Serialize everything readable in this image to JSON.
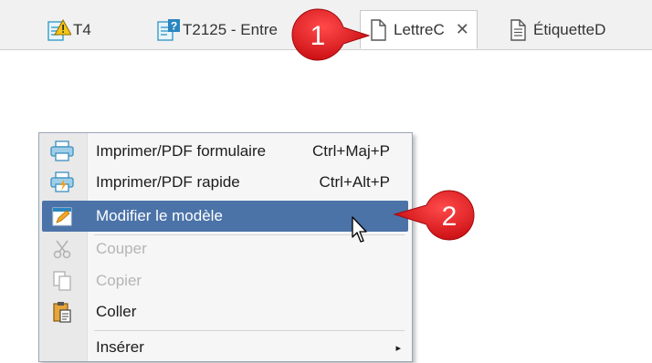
{
  "tabs": [
    {
      "label": "T4",
      "icon": "doc-warning-icon"
    },
    {
      "label": "T2125 - Entre",
      "icon": "doc-question-icon"
    },
    {
      "label": "LettreC",
      "icon": "document-icon",
      "active": true,
      "close": "✕"
    },
    {
      "label": "ÉtiquetteD",
      "icon": "document-lines-icon"
    }
  ],
  "callouts": {
    "one": "1",
    "two": "2",
    "color": "#e8161b"
  },
  "menu": {
    "items": [
      {
        "label": "Imprimer/PDF formulaire",
        "shortcut": "Ctrl+Maj+P",
        "icon": "printer-icon"
      },
      {
        "label": "Imprimer/PDF rapide",
        "shortcut": "Ctrl+Alt+P",
        "icon": "printer-fast-icon"
      },
      {
        "label": "Modifier le modèle",
        "shortcut": "",
        "icon": "edit-template-icon",
        "highlighted": true
      },
      {
        "label": "Couper",
        "shortcut": "",
        "icon": "scissors-icon",
        "disabled": true
      },
      {
        "label": "Copier",
        "shortcut": "",
        "icon": "copy-icon",
        "disabled": true
      },
      {
        "label": "Coller",
        "shortcut": "",
        "icon": "paste-icon"
      },
      {
        "label": "Insérer",
        "shortcut": "",
        "icon": "",
        "submenu": "▸"
      }
    ],
    "highlight_color": "#4b73a8"
  }
}
